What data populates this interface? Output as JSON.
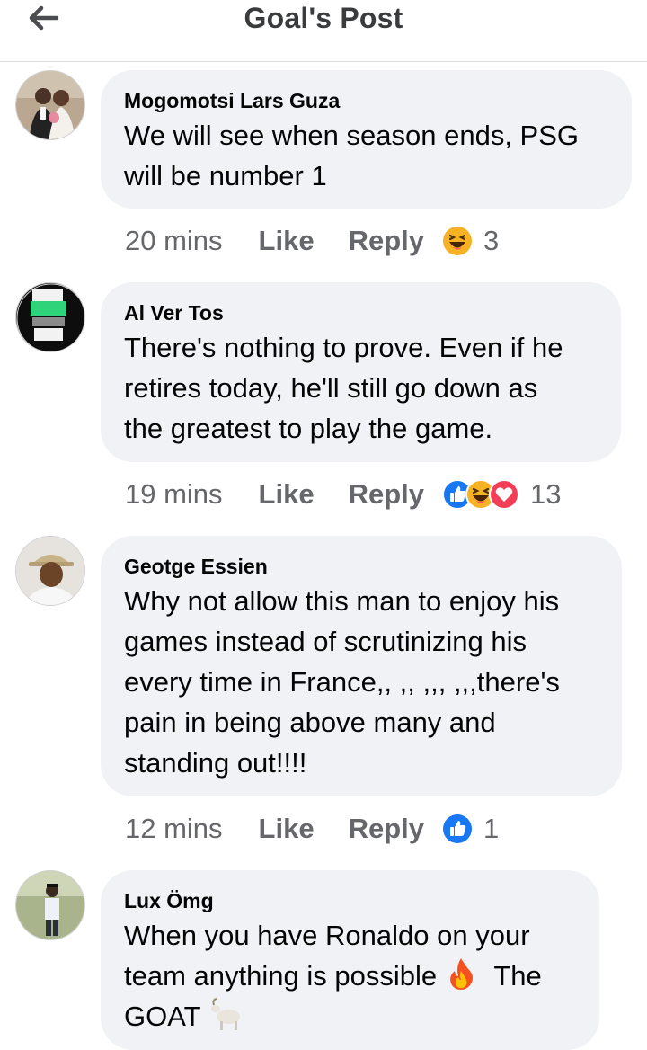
{
  "header": {
    "title": "Goal's Post",
    "back_icon": "arrow-left-icon"
  },
  "comments": [
    {
      "author": "Mogomotsi Lars Guza",
      "lines": [
        "We will see when season ends, PSG",
        "will be number 1"
      ],
      "time": "20 mins",
      "like": "Like",
      "reply": "Reply",
      "reactions": [
        "haha-reaction-icon"
      ],
      "reaction_count": "3"
    },
    {
      "author": "Al Ver Tos",
      "lines": [
        "There's nothing to prove. Even if he",
        "retires today, he'll still go down as",
        "the greatest to play the game."
      ],
      "time": "19 mins",
      "like": "Like",
      "reply": "Reply",
      "reactions": [
        "like-reaction-icon",
        "haha-reaction-icon",
        "love-reaction-icon"
      ],
      "reaction_count": "13"
    },
    {
      "author": "Geotge Essien",
      "lines": [
        "Why not allow this man to enjoy his",
        "games instead of scrutinizing his",
        "every time in France,, ,, ,,, ,,,there's",
        "pain in being above many and",
        "standing out!!!!"
      ],
      "time": "12 mins",
      "like": "Like",
      "reply": "Reply",
      "reactions": [
        "like-reaction-icon"
      ],
      "reaction_count": "1"
    },
    {
      "author": "Lux Ömg",
      "lines": [
        "When you have Ronaldo on your",
        "team anything is possible",
        "The",
        "GOAT"
      ],
      "emojis": [
        "fire-emoji-icon",
        "goat-emoji-icon"
      ]
    }
  ],
  "colors": {
    "bubble": "#f0f2f5",
    "meta_text": "#65676b",
    "like_blue": "#1877f2",
    "love_red": "#f33e58",
    "haha_yellow": "#f7b125"
  }
}
